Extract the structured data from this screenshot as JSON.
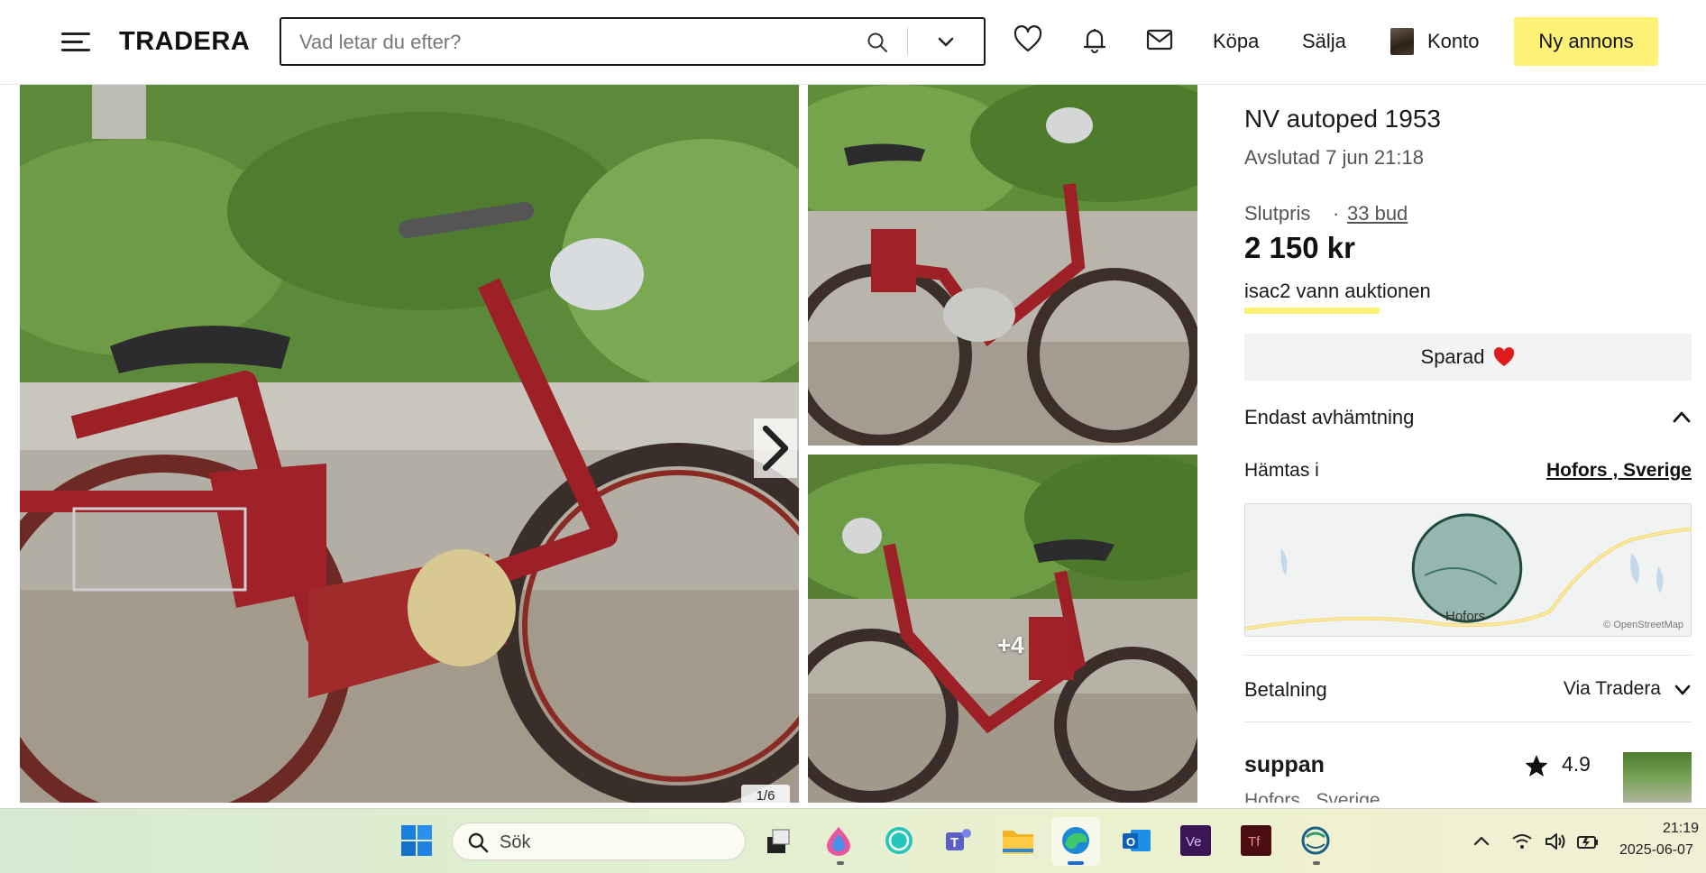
{
  "header": {
    "logo": "TRADERA",
    "search_placeholder": "Vad letar du efter?",
    "nav": {
      "buy": "Köpa",
      "sell": "Sälja",
      "account": "Konto",
      "new_listing": "Ny annons"
    },
    "cta_color": "#fdf176"
  },
  "gallery": {
    "counter": "1/6",
    "more_images": "+4"
  },
  "listing": {
    "title": "NV autoped 1953",
    "ended": "Avslutad 7 jun 21:18",
    "final_price_label": "Slutpris",
    "separator": "·",
    "bids": "33 bud",
    "price": "2 150 kr",
    "winner": "isac2 vann auktionen",
    "saved_label": "Sparad",
    "shipping_label": "Endast avhämtning",
    "pickup_label": "Hämtas i",
    "pickup_location": "Hofors , Sverige",
    "map_town": "Hofors",
    "map_credit": "© OpenStreetMap",
    "payment_label": "Betalning",
    "payment_value": "Via Tradera",
    "seller_name": "suppan",
    "seller_rating": "4.9",
    "seller_location": "Hofors , Sverige"
  },
  "taskbar": {
    "search_label": "Sök",
    "time": "21:19",
    "date": "2025-06-07",
    "apps": [
      "widgets-app",
      "paint-app",
      "whatsapp-app",
      "teams-app",
      "file-explorer-app",
      "edge-app",
      "outlook-app",
      "vegas-app",
      "typeface-app",
      "browser-app"
    ]
  },
  "colors": {
    "accent_yellow": "#fdf176",
    "heart_red": "#e0191b"
  }
}
